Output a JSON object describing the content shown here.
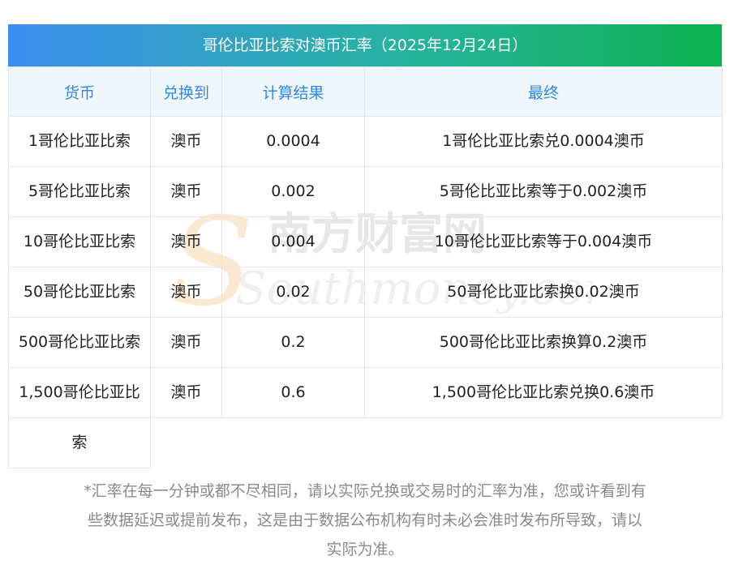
{
  "title": "哥伦比亚比索对澳币汇率（2025年12月24日）",
  "headers": [
    "货币",
    "兑换到",
    "计算结果",
    "最终"
  ],
  "rows": [
    {
      "currency": "1哥伦比亚比索",
      "to": "澳币",
      "result": "0.0004",
      "final": "1哥伦比亚比索兑0.0004澳币"
    },
    {
      "currency": "5哥伦比亚比索",
      "to": "澳币",
      "result": "0.002",
      "final": "5哥伦比亚比索等于0.002澳币"
    },
    {
      "currency": "10哥伦比亚比索",
      "to": "澳币",
      "result": "0.004",
      "final": "10哥伦比亚比索等于0.004澳币"
    },
    {
      "currency": "50哥伦比亚比索",
      "to": "澳币",
      "result": "0.02",
      "final": "50哥伦比亚比索换0.02澳币"
    },
    {
      "currency": "500哥伦比亚比索",
      "to": "澳币",
      "result": "0.2",
      "final": "500哥伦比亚比索换算0.2澳币"
    },
    {
      "currency_line1": "1,500哥伦比亚比",
      "currency_line2": "索",
      "to": "澳币",
      "result": "0.6",
      "final": "1,500哥伦比亚比索兑换0.6澳币"
    }
  ],
  "watermark": {
    "cn": "南方财富网",
    "en": "Southmoney.com"
  },
  "footnote": {
    "line1": "*汇率在每一分钟或都不尽相同，请以实际兑换或交易时的汇率为准，您或许看到有",
    "line2": "些数据延迟或提前发布，这是由于数据公布机构有时未必会准时发布所导致，请以",
    "line3": "实际为准。"
  }
}
